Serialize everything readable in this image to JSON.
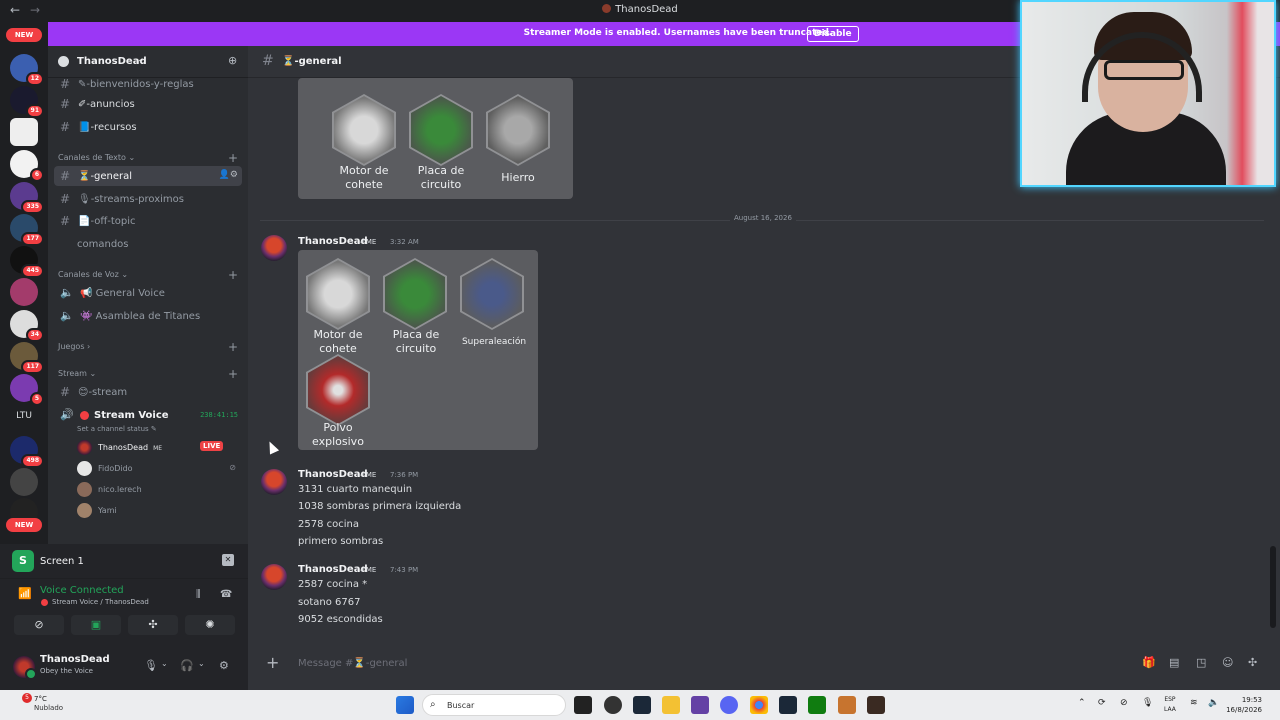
{
  "window": {
    "title": "ThanosDead",
    "back": "←",
    "forward": "→"
  },
  "banner": {
    "text": "Streamer Mode is enabled. Usernames have been truncated.",
    "button": "Disable"
  },
  "guild_badges": [
    "NEW",
    "12",
    "91",
    "6",
    "335",
    "177",
    "445",
    "34",
    "117",
    "5",
    "498",
    "NEW"
  ],
  "guild_text": "LTU",
  "server": {
    "name": "ThanosDead",
    "chevron": "⌄",
    "invite_icon": "👤+"
  },
  "channels": {
    "top": [
      {
        "name": "-bienvenidos-y-reglas",
        "emoji": "✎"
      },
      {
        "name": "-anuncios",
        "emoji": "✐"
      },
      {
        "name": "-recursos",
        "emoji": "📘"
      }
    ],
    "text_category": "Canales de Texto",
    "text": [
      {
        "name": "-general",
        "emoji": "⏳",
        "active": true
      },
      {
        "name": "-streams-proximos",
        "emoji": "🎙"
      },
      {
        "name": "-off-topic",
        "emoji": "📄"
      },
      {
        "name": "comandos",
        "emoji": ""
      }
    ],
    "voice_category": "Canales de Voz",
    "voice": [
      {
        "name": "General Voice",
        "emoji": "📢"
      },
      {
        "name": "Asamblea de Titanes",
        "emoji": "👾"
      }
    ],
    "games_category": "Juegos",
    "stream_category": "Stream",
    "stream_text": "-stream",
    "stream_voice": "Stream Voice",
    "stream_timer": "238:41:15",
    "channel_status": "Set a channel status ✎",
    "voice_users": [
      {
        "name": "ThanosDead",
        "badge": "ME",
        "live": "LIVE"
      },
      {
        "name": "FidoDido"
      },
      {
        "name": "nico.lerech"
      },
      {
        "name": "Yami"
      }
    ]
  },
  "panel": {
    "screen_label": "Screen 1",
    "voice_connected": "Voice Connected",
    "voice_sub": "Stream Voice / ThanosDead",
    "user_name": "ThanosDead",
    "user_status": "Obey the Voice"
  },
  "chat": {
    "channel": "-general",
    "date_divider": "August 16, 2026",
    "embed1_items": [
      "Motor de cohete",
      "Placa de circuito",
      "Hierro"
    ],
    "embed2_items": [
      "Motor de cohete",
      "Placa de circuito",
      "Superaleación",
      "Polvo explosivo"
    ],
    "messages": [
      {
        "author": "ThanosDead",
        "badge": "ME",
        "time": "3:32 AM"
      },
      {
        "author": "ThanosDead",
        "badge": "ME",
        "time": "7:36 PM",
        "lines": [
          "3131 cuarto manequin",
          "1038 sombras primera izquierda",
          "2578 cocina",
          "primero sombras"
        ]
      },
      {
        "author": "ThanosDead",
        "badge": "ME",
        "time": "7:43 PM",
        "lines": [
          "2587 cocina *",
          "sotano 6767",
          "9052 escondidas"
        ]
      }
    ],
    "composer_placeholder": "Message #⏳-general"
  },
  "taskbar": {
    "weather_badge": "5",
    "temp": "7°C",
    "condition": "Nublado",
    "search": "Buscar",
    "lang_top": "ESP",
    "lang_bottom": "LAA",
    "time": "19:53",
    "date": "16/8/2026"
  },
  "colors": {
    "accent": "#9b37f5",
    "online": "#23a55a",
    "danger": "#f23f43",
    "webcam_border": "#52d6ff"
  }
}
